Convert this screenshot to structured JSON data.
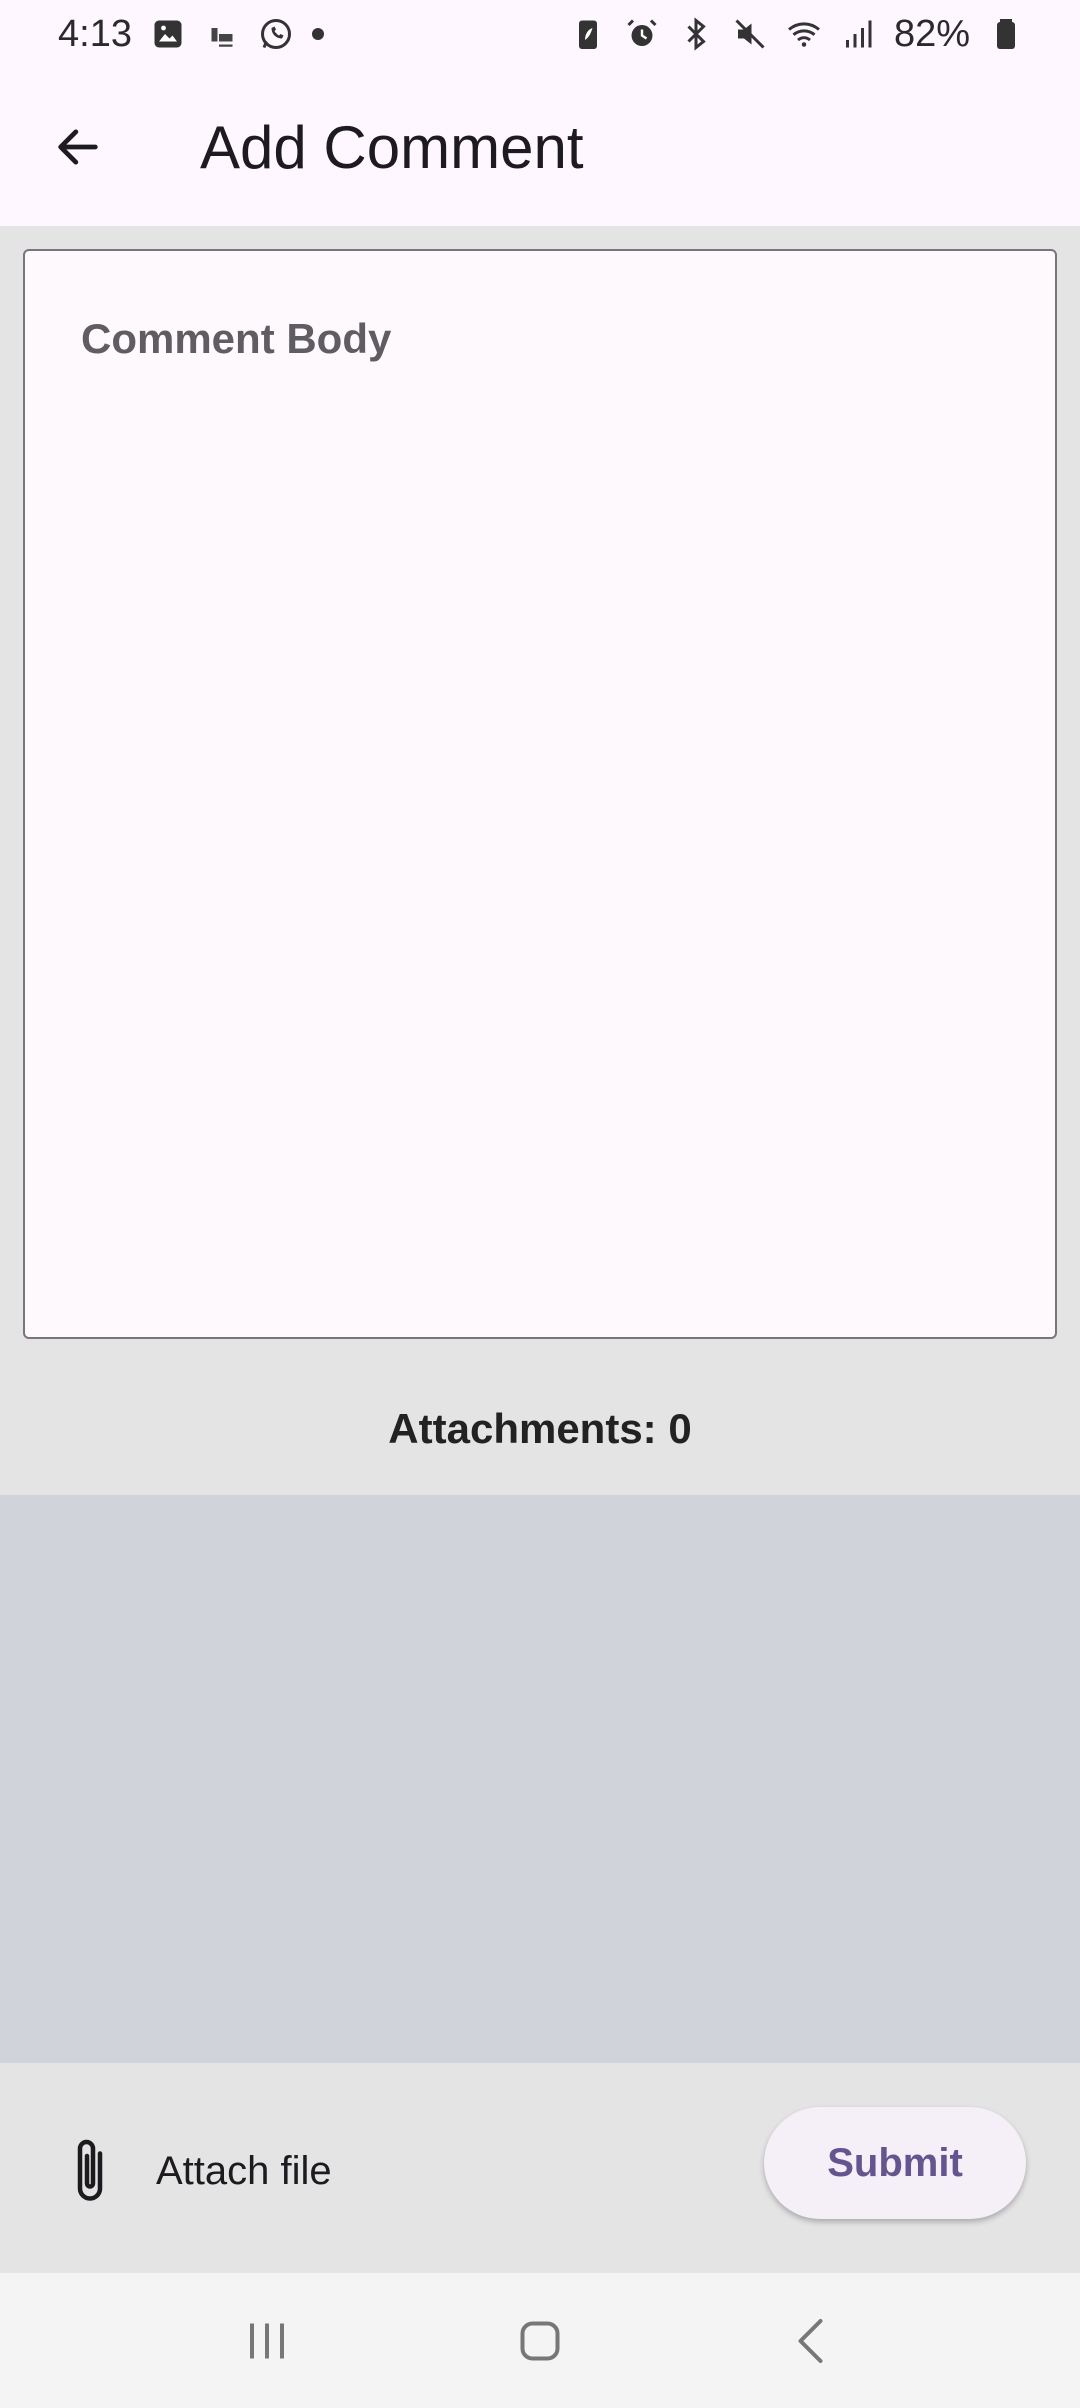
{
  "status_bar": {
    "time": "4:13",
    "battery": "82%",
    "left_icons": [
      "image-icon",
      "notification-icon",
      "whatsapp-icon",
      "dot-icon"
    ],
    "right_icons": [
      "battery-saver-icon",
      "alarm-icon",
      "bluetooth-icon",
      "mute-icon",
      "wifi-icon",
      "signal-icon",
      "battery-icon"
    ]
  },
  "app_bar": {
    "title": "Add Comment",
    "back_icon": "arrow-left-icon"
  },
  "comment": {
    "placeholder": "Comment Body",
    "value": ""
  },
  "attachments": {
    "label": "Attachments: 0"
  },
  "actions": {
    "attach_label": "Attach file",
    "attach_icon": "paperclip-icon",
    "submit_label": "Submit"
  },
  "nav_bar": {
    "icons": [
      "recents-icon",
      "home-icon",
      "back-nav-icon"
    ]
  },
  "colors": {
    "surface": "#fef7ff",
    "background": "#e4e4e4",
    "attachments_area": "#d0d3da",
    "accent": "#65558f"
  }
}
